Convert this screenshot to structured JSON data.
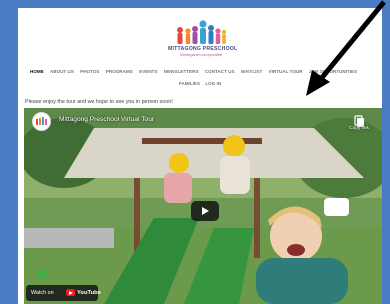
{
  "logo": {
    "title": "MITTAGONG PRESCHOOL",
    "subtitle": "Kindergarten Incorporated"
  },
  "nav": {
    "items": [
      "HOME",
      "ABOUT US",
      "PHOTOS",
      "PROGRAMS",
      "EVENTS",
      "NEWSLETTERS",
      "CONTACT US",
      "WAITLIST",
      "VIRTUAL TOUR",
      "JOB OPPORTUNITIES"
    ],
    "row2": [
      "FAMILIES",
      "LOG IN"
    ],
    "active": "HOME"
  },
  "intro_text": "Please enjoy the tour and we hope to see you in person soon!",
  "video": {
    "title": "Mittagong Preschool Virtual Tour",
    "copy_link": "Copy link",
    "watch_on": "Watch on",
    "platform": "YouTube"
  },
  "colors": {
    "frame_background": "#4a7cc4",
    "logo_title": "#3f4f8c",
    "youtube_red": "#e62117"
  },
  "icons": {
    "annotation_arrow": "arrow-icon",
    "play": "play-icon",
    "copy": "copy-icon",
    "channel": "channel-avatar-icon"
  }
}
